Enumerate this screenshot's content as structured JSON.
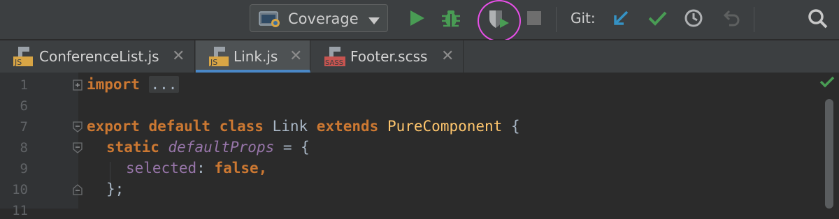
{
  "toolbar": {
    "run_config": {
      "icon": "run-configuration-icon",
      "label": "Coverage",
      "dropdown_icon": "chevron-down-icon"
    },
    "actions": [
      {
        "name": "run",
        "icon": "play-icon",
        "color": "#499c54"
      },
      {
        "name": "debug",
        "icon": "bug-icon",
        "color": "#499c54"
      },
      {
        "name": "run-with-coverage",
        "icon": "coverage-shield-icon",
        "color": "#afb1b3"
      },
      {
        "name": "stop",
        "icon": "stop-icon",
        "color": "#6e6e6e"
      }
    ],
    "git": {
      "label": "Git:",
      "update_icon": "update-project-arrow-icon",
      "commit_icon": "commit-check-icon",
      "history_icon": "history-clock-icon",
      "rollback_icon": "rollback-icon"
    },
    "search_icon": "search-icon"
  },
  "tabs": [
    {
      "label": "ConferenceList.js",
      "file_type": "JS",
      "active": false
    },
    {
      "label": "Link.js",
      "file_type": "JS",
      "active": true
    },
    {
      "label": "Footer.scss",
      "file_type": "SASS",
      "active": false
    }
  ],
  "editor": {
    "line_numbers": [
      "1",
      "6",
      "7",
      "8",
      "9",
      "10",
      "11"
    ],
    "lines": {
      "l1": {
        "kw": "import",
        "collapsed": "..."
      },
      "l7": {
        "kw1": "export",
        "kw2": "default",
        "kw3": "class",
        "name": "Link",
        "kw4": "extends",
        "super": "PureComponent",
        "brace": " {"
      },
      "l8": {
        "kw": "static",
        "prop": "defaultProps",
        "rest": " = {"
      },
      "l9": {
        "prop": "selected",
        "colon": ": ",
        "kw": "false",
        "comma": ","
      },
      "l10": {
        "text": "};"
      }
    },
    "inspection_status_icon": "inspection-ok-check-icon"
  },
  "colors": {
    "accent_tab_underline": "#4a88c7",
    "highlight_ring": "#e84fe8",
    "keyword": "#cc7832",
    "property": "#9876aa",
    "superclass": "#ffc66d"
  }
}
